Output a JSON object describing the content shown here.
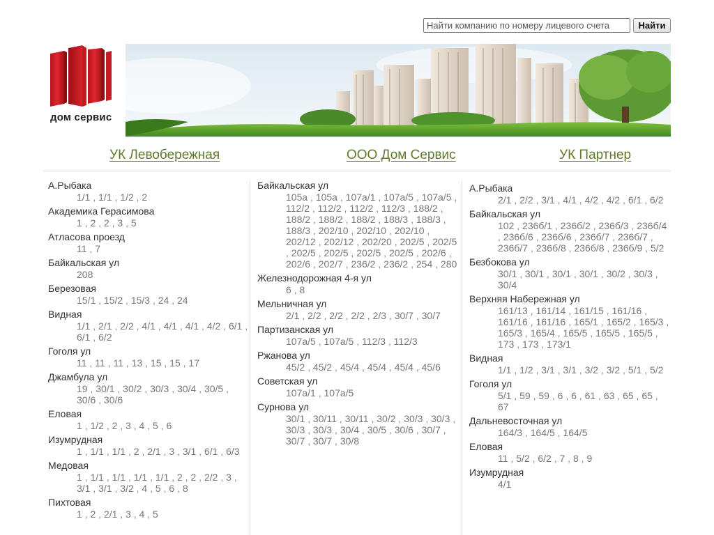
{
  "search": {
    "placeholder": "Найти компанию по номеру лицевого счета",
    "button_label": "Найти"
  },
  "logo": {
    "text": "дом сервис"
  },
  "colors": {
    "link": "#5f7a2e",
    "logo_red": "#d31f26",
    "muted": "#777777"
  },
  "nav": {
    "links": [
      "УК Левобережная",
      "ООО Дом Сервис",
      "УК Партнер"
    ]
  },
  "columns": [
    {
      "title": "УК Левобережная",
      "streets": [
        {
          "name": "А.Рыбака",
          "houses": [
            "1/1",
            "1/1",
            "1/2",
            "2"
          ]
        },
        {
          "name": "Академика Герасимова",
          "houses": [
            "1",
            "2",
            "2",
            "3",
            "5"
          ]
        },
        {
          "name": "Атласова проезд",
          "houses": [
            "11",
            "7"
          ]
        },
        {
          "name": "Байкальская ул",
          "houses": [
            "208"
          ]
        },
        {
          "name": "Березовая",
          "houses": [
            "15/1",
            "15/2",
            "15/3",
            "24",
            "24"
          ]
        },
        {
          "name": "Видная",
          "houses": [
            "1/1",
            "2/1",
            "2/2",
            "4/1",
            "4/1",
            "4/1",
            "4/2",
            "6/1",
            "6/1",
            "6/2"
          ]
        },
        {
          "name": "Гоголя ул",
          "houses": [
            "11",
            "11",
            "11",
            "13",
            "15",
            "15",
            "17"
          ]
        },
        {
          "name": "Джамбула ул",
          "houses": [
            "19",
            "30/1",
            "30/2",
            "30/3",
            "30/4",
            "30/5",
            "30/6",
            "30/6"
          ]
        },
        {
          "name": "Еловая",
          "houses": [
            "1",
            "1/2",
            "2",
            "3",
            "4",
            "5",
            "6"
          ]
        },
        {
          "name": "Изумрудная",
          "houses": [
            "1",
            "1/1",
            "1/1",
            "2",
            "2/1",
            "3",
            "3/1",
            "6/1",
            "6/3"
          ]
        },
        {
          "name": "Медовая",
          "houses": [
            "1",
            "1/1",
            "1/1",
            "1/1",
            "1/1",
            "2",
            "2",
            "2/2",
            "3",
            "3/1",
            "3/1",
            "3/2",
            "4",
            "5",
            "6",
            "8"
          ]
        },
        {
          "name": "Пихтовая",
          "houses": [
            "1",
            "2",
            "2/1",
            "3",
            "4",
            "5"
          ]
        }
      ]
    },
    {
      "title": "ООО Дом Сервис",
      "streets": [
        {
          "name": "Байкальская ул",
          "houses": [
            "105а",
            "105а",
            "107а/1",
            "107а/5",
            "107а/5",
            "112/2",
            "112/2",
            "112/2",
            "112/3",
            "188/2",
            "188/2",
            "188/2",
            "188/2",
            "188/3",
            "188/3",
            "188/3",
            "202/10",
            "202/10",
            "202/10",
            "202/12",
            "202/12",
            "202/20",
            "202/5",
            "202/5",
            "202/5",
            "202/5",
            "202/5",
            "202/5",
            "202/6",
            "202/6",
            "202/7",
            "236/2",
            "236/2",
            "254",
            "280"
          ]
        },
        {
          "name": "Железнодорожная 4-я ул",
          "houses": [
            "6",
            "8"
          ]
        },
        {
          "name": "Мельничная ул",
          "houses": [
            "2/1",
            "2/2",
            "2/2",
            "2/2",
            "2/3",
            "30/7",
            "30/7"
          ]
        },
        {
          "name": "Партизанская ул",
          "houses": [
            "107а/5",
            "107а/5",
            "112/3",
            "112/3"
          ]
        },
        {
          "name": "Ржанова ул",
          "houses": [
            "45/2",
            "45/2",
            "45/4",
            "45/4",
            "45/4",
            "45/6"
          ]
        },
        {
          "name": "Советская ул",
          "houses": [
            "107а/1",
            "107а/5"
          ]
        },
        {
          "name": "Сурнова ул",
          "houses": [
            "30/1",
            "30/11",
            "30/11",
            "30/2",
            "30/3",
            "30/3",
            "30/3",
            "30/3",
            "30/4",
            "30/5",
            "30/6",
            "30/7",
            "30/7",
            "30/7",
            "30/8"
          ]
        }
      ]
    },
    {
      "title": "УК Партнер",
      "streets": [
        {
          "name": "А.Рыбака",
          "houses": [
            "2/1",
            "2/2",
            "3/1",
            "4/1",
            "4/2",
            "4/2",
            "6/1",
            "6/2"
          ]
        },
        {
          "name": "Байкальская ул",
          "houses": [
            "102",
            "236б/1",
            "236б/2",
            "236б/3",
            "236б/4",
            "236б/6",
            "236б/6",
            "236б/7",
            "236б/7",
            "236б/7",
            "236б/8",
            "236б/8",
            "236б/9",
            "5/2"
          ]
        },
        {
          "name": "Безбокова ул",
          "houses": [
            "30/1",
            "30/1",
            "30/1",
            "30/1",
            "30/2",
            "30/3",
            "30/4"
          ]
        },
        {
          "name": "Верхняя Набережная ул",
          "houses": [
            "161/13",
            "161/14",
            "161/15",
            "161/16",
            "161/16",
            "161/16",
            "165/1",
            "165/2",
            "165/3",
            "165/3",
            "165/4",
            "165/5",
            "165/5",
            "165/5",
            "173",
            "173",
            "173/1"
          ]
        },
        {
          "name": "Видная",
          "houses": [
            "1/1",
            "1/2",
            "3/1",
            "3/1",
            "3/2",
            "3/2",
            "5/1",
            "5/2"
          ]
        },
        {
          "name": "Гоголя ул",
          "houses": [
            "5/1",
            "59",
            "59",
            "6",
            "6",
            "61",
            "63",
            "65",
            "65",
            "67"
          ]
        },
        {
          "name": "Дальневосточная ул",
          "houses": [
            "164/3",
            "164/5",
            "164/5"
          ]
        },
        {
          "name": "Еловая",
          "houses": [
            "11",
            "5/2",
            "6/2",
            "7",
            "8",
            "9"
          ]
        },
        {
          "name": "Изумрудная",
          "houses": [
            "4/1"
          ]
        }
      ]
    }
  ]
}
